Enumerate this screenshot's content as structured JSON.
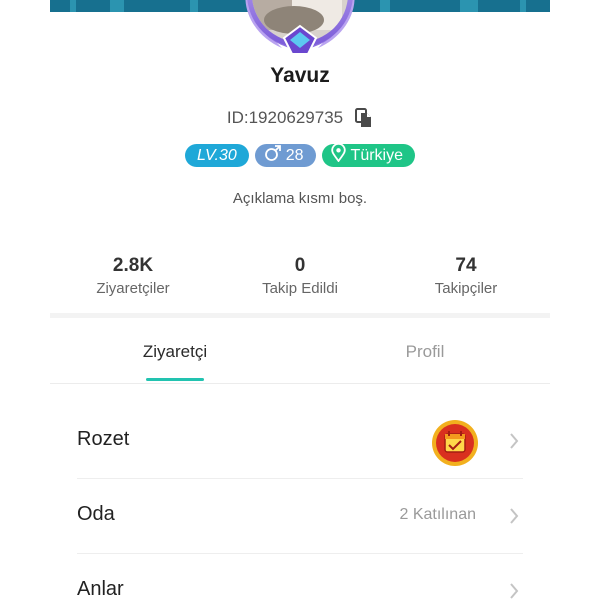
{
  "profile": {
    "name": "Yavuz",
    "id_text": "ID:1920629735",
    "level": "LV.30",
    "age": "28",
    "country": "Türkiye",
    "description": "Açıklama kısmı boş."
  },
  "stats": [
    {
      "value": "2.8K",
      "label": "Ziyaretçiler"
    },
    {
      "value": "0",
      "label": "Takip Edildi"
    },
    {
      "value": "74",
      "label": "Takipçiler"
    }
  ],
  "tabs": {
    "active": "Ziyaretçi",
    "inactive": "Profil"
  },
  "rows": {
    "rozet": {
      "title": "Rozet"
    },
    "oda": {
      "title": "Oda",
      "value": "2 Katılınan"
    },
    "anlar": {
      "title": "Anlar"
    }
  },
  "colors": {
    "level_badge": "#1fa8d8",
    "age_badge": "#6f9bd2",
    "country_badge": "#1fc587",
    "tab_indicator": "#22c3b0",
    "cover": "#17708f"
  },
  "icons": {
    "copy": "copy-icon",
    "gender": "male-icon",
    "location": "location-pin-icon",
    "chevron": "chevron-right-icon",
    "badge": "calendar-medal-icon"
  }
}
